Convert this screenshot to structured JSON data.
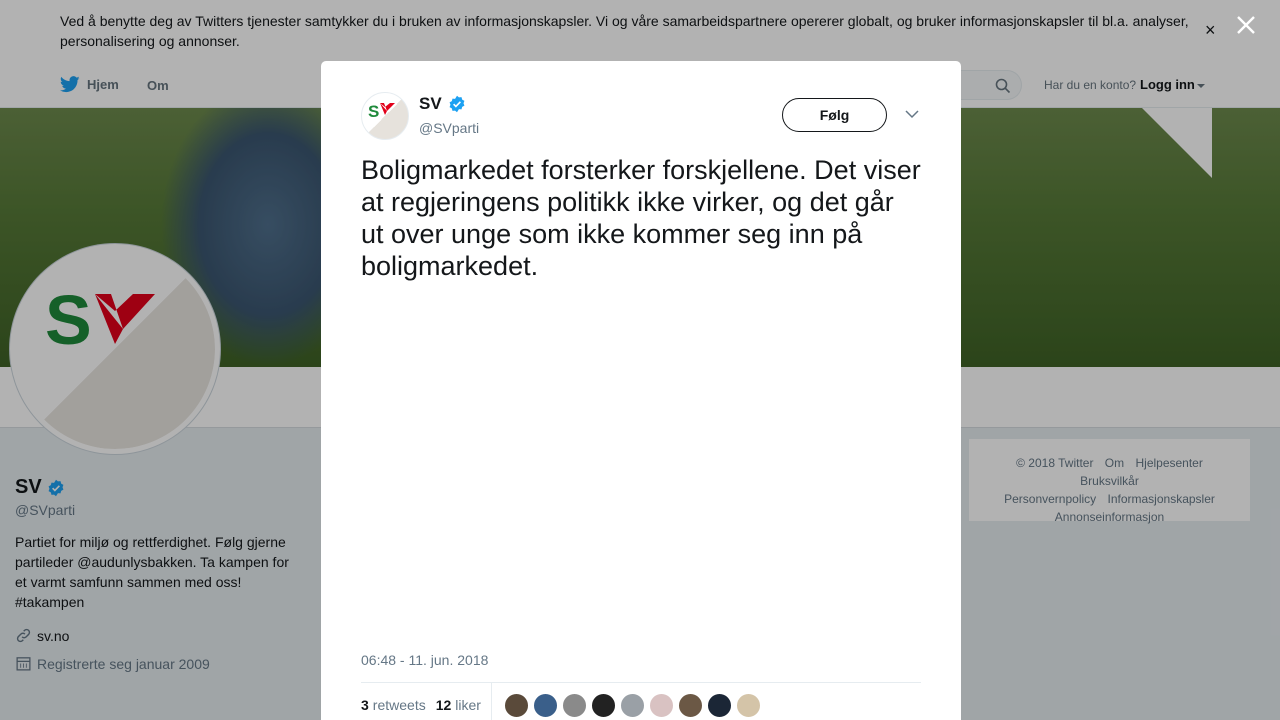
{
  "cookie_banner": {
    "text": "Ved å benytte deg av Twitters tjenester samtykker du i bruken av informasjonskapsler. Vi og våre samarbeidspartnere opererer globalt, og bruker informasjonskapsler til bl.a. analyser, personalisering og annonser.",
    "close": "×"
  },
  "topnav": {
    "home": "Hjem",
    "about": "Om",
    "account_question": "Har du en konto?",
    "login": "Logg inn"
  },
  "profile": {
    "name": "SV",
    "handle": "@SVparti",
    "bio": "Partiet for miljø og rettferdighet. Følg gjerne partileder @audunlysbakken. Ta kampen for et varmt samfunn sammen med oss! #takampen",
    "url": "sv.no",
    "joined": "Registrerte seg januar 2009"
  },
  "footer": {
    "items": [
      "© 2018 Twitter",
      "Om",
      "Hjelpesenter",
      "Bruksvilkår",
      "Personvernpolicy",
      "Informasjonskapsler",
      "Annonseinformasjon"
    ]
  },
  "tweet": {
    "name": "SV",
    "handle": "@SVparti",
    "follow": "Følg",
    "text": "Boligmarkedet forsterker forskjellene. Det viser at regjeringens politikk ikke virker, og det går ut over unge som ikke kommer seg inn på boligmarkedet.",
    "timestamp": "06:48 - 11. jun. 2018",
    "retweets_count": "3",
    "retweets_label": "retweets",
    "likes_count": "12",
    "likes_label": "liker"
  },
  "colors": {
    "twitter_blue": "#1da1f2",
    "sv_red": "#e2001a",
    "sv_green": "#1f8a3b",
    "text": "#14171a",
    "muted": "#657786"
  },
  "likers": [
    {
      "color": "#5a4a3a"
    },
    {
      "color": "#3a5f8a"
    },
    {
      "color": "#8a8a8a"
    },
    {
      "color": "#222222"
    },
    {
      "color": "#9aa0a6"
    },
    {
      "color": "#d9c2c2"
    },
    {
      "color": "#6b5845"
    },
    {
      "color": "#1b2636"
    },
    {
      "color": "#d4c4a8"
    }
  ]
}
